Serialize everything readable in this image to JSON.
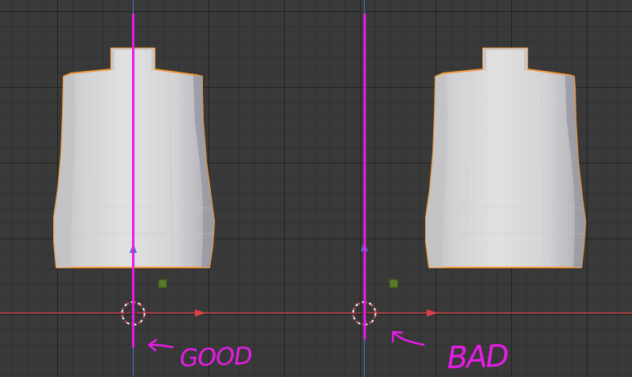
{
  "viewport": {
    "colors": {
      "background": "#393939",
      "x_axis": "#d9414a",
      "z_axis": "#4d73c9",
      "selection_outline": "#f0973a",
      "object_light": "#dcdcdc",
      "object_shade": "#a5a5ad",
      "annotation": "#e81ce8",
      "origin_marker": "#5a7a2a"
    }
  },
  "annotations": {
    "good_label": "GOOD",
    "bad_label": "BAD"
  },
  "icons": [
    "3d-cursor-icon",
    "origin-point-icon",
    "axis-arrow-icon",
    "annotation-arrow-icon"
  ]
}
